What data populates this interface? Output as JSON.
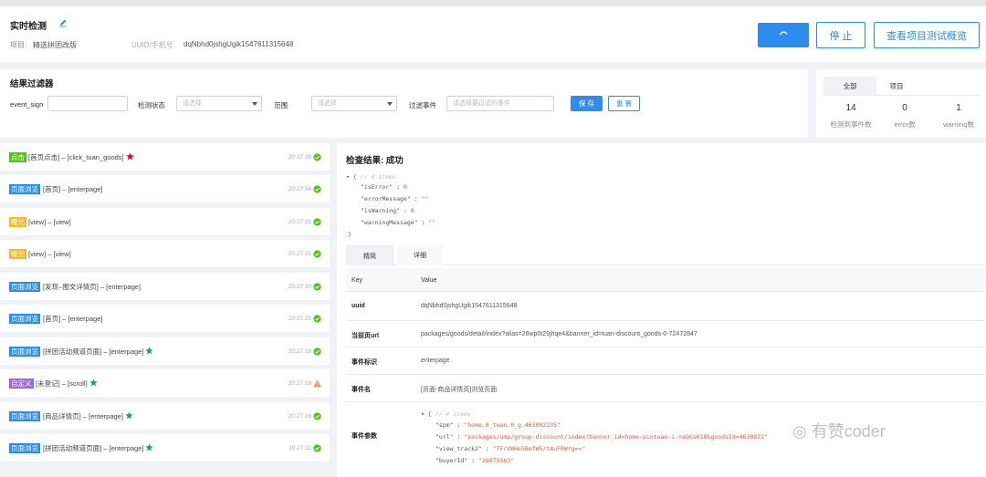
{
  "header": {
    "title": "实时检测",
    "project_label": "项目:",
    "project_value": "精选拼团改版",
    "uuid_label": "UUID/手机号:",
    "uuid_value": "dqNbhd0jshgUgik1547611315648",
    "stop_label": "停 止",
    "overview_label": "查看项目测试概览"
  },
  "filter": {
    "title": "结果过滤器",
    "event_sign_label": "event_sign",
    "event_sign_value": "",
    "status_label": "检测状态",
    "status_placeholder": "请选择",
    "range_label": "范围",
    "range_placeholder": "请选择",
    "filter_event_label": "过滤事件",
    "filter_event_placeholder": "请选择要过滤的事件",
    "save_label": "保 存",
    "reset_label": "重 置"
  },
  "stats": {
    "tabs": [
      "全部",
      "项目"
    ],
    "items": [
      {
        "value": "14",
        "label": "检测到事件数"
      },
      {
        "value": "0",
        "label": "error数"
      },
      {
        "value": "1",
        "label": "warning数"
      }
    ]
  },
  "events": [
    {
      "tag": "点击",
      "tag_color": "#52c41a",
      "text": "[首页点击] – [click_tuan_goods]",
      "time": "20:27:36",
      "status": "ok",
      "star": "red"
    },
    {
      "tag": "页面浏览",
      "tag_color": "#2d8cf0",
      "text": "[首页] – [enterpage]",
      "time": "20:27:34",
      "status": "ok",
      "star": ""
    },
    {
      "tag": "曝光",
      "tag_color": "#f7ba2a",
      "text": "[view] – [view]",
      "time": "20:27:31",
      "status": "ok",
      "star": ""
    },
    {
      "tag": "曝光",
      "tag_color": "#f7ba2a",
      "text": "[view] – [view]",
      "time": "20:27:31",
      "status": "ok",
      "star": ""
    },
    {
      "tag": "页面浏览",
      "tag_color": "#2d8cf0",
      "text": "[发现–图文详情页] – [enterpage]",
      "time": "20:27:30",
      "status": "ok",
      "star": ""
    },
    {
      "tag": "页面浏览",
      "tag_color": "#2d8cf0",
      "text": "[首页] – [enterpage]",
      "time": "20:27:25",
      "status": "ok",
      "star": ""
    },
    {
      "tag": "页面浏览",
      "tag_color": "#2d8cf0",
      "text": "[拼团活动频道页面] – [enterpage]",
      "time": "20:27:19",
      "status": "ok",
      "star": "green"
    },
    {
      "tag": "自定义",
      "tag_color": "#9c6ad6",
      "text": "[未登记] – [scroll]",
      "time": "20:27:18",
      "status": "warn",
      "star": "green"
    },
    {
      "tag": "页面浏览",
      "tag_color": "#2d8cf0",
      "text": "[商品详情页] – [enterpage]",
      "time": "20:27:16",
      "status": "ok",
      "star": "green"
    },
    {
      "tag": "页面浏览",
      "tag_color": "#2d8cf0",
      "text": "[拼团活动频道页面] – [enterpage]",
      "time": "20:27:11",
      "status": "ok",
      "star": "green"
    }
  ],
  "detail": {
    "title": "检查结果: 成功",
    "json_comment": "// 4 items",
    "json_fields": [
      {
        "key": "\"isError\"",
        "value": "0",
        "type": "num"
      },
      {
        "key": "\"errorMessage\"",
        "value": "\"\"",
        "type": "str"
      },
      {
        "key": "\"isWarning\"",
        "value": "0",
        "type": "num"
      },
      {
        "key": "\"warningMessage\"",
        "value": "\"\"",
        "type": "str"
      }
    ],
    "tabs": [
      "精简",
      "详细"
    ],
    "table_header": {
      "key": "Key",
      "value": "Value"
    },
    "rows": [
      {
        "key": "uuid",
        "value": "dqNbhd0jshgUgik1547611315648"
      },
      {
        "key": "当前页url",
        "value": "packages/goods/detail/index?alias=26wp0t29jhqe4&banner_id=tuan-discount_goods-0-72472847"
      },
      {
        "key": "事件标识",
        "value": "enterpage"
      },
      {
        "key": "事件名",
        "value": "[页面-商品详情页]浏览页面"
      },
      {
        "key": "事件参数",
        "value": ""
      }
    ],
    "params_comment": "// 4 items",
    "params": [
      {
        "key": "\"spm\"",
        "value": "\"home.0_tuan.0_g.463092235\""
      },
      {
        "key": "\"url\"",
        "value": "\"packages/ump/group-discount/index?banner_id=home-pintuan-i-naQGsK18&goodsId=4630922\""
      },
      {
        "key": "\"view_track2\"",
        "value": "\"TFrVWHe5BefW5/t4uFRWrg==\""
      },
      {
        "key": "\"buyerId\"",
        "value": "\"26975563\""
      }
    ]
  },
  "watermark": "有赞coder"
}
